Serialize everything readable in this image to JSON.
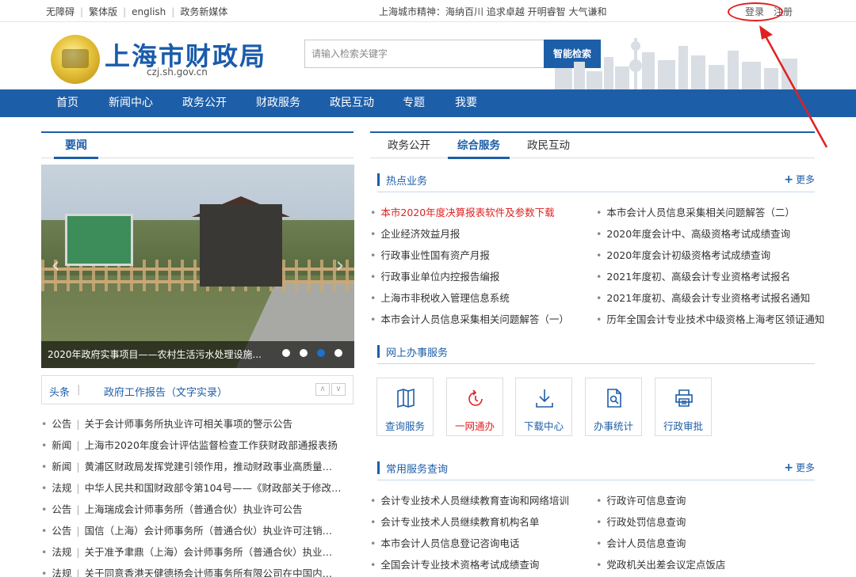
{
  "topbar": {
    "links": [
      "无障碍",
      "繁体版",
      "english",
      "政务新媒体"
    ],
    "spirit": "上海城市精神：海纳百川 追求卓越 开明睿智 大气谦和",
    "login": "登录",
    "register": "注册"
  },
  "header": {
    "title": "上海市财政局",
    "domain": "czj.sh.gov.cn",
    "search_placeholder": "请输入检索关键字",
    "search_button": "智能检索"
  },
  "nav": [
    "首页",
    "新闻中心",
    "政务公开",
    "财政服务",
    "政民互动",
    "专题",
    "我要"
  ],
  "left": {
    "tab": "要闻",
    "slide_caption": "2020年政府实事项目——农村生活污水处理设施...",
    "subtabs": [
      "头条",
      "政府工作报告（文字实录）"
    ],
    "news": [
      {
        "cat": "公告",
        "text": "关于会计师事务所执业许可相关事项的警示公告"
      },
      {
        "cat": "新闻",
        "text": "上海市2020年度会计评估监督检查工作获财政部通报表扬"
      },
      {
        "cat": "新闻",
        "text": "黄浦区财政局发挥党建引领作用，推动财政事业高质量…"
      },
      {
        "cat": "法规",
        "text": "中华人民共和国财政部令第104号——《财政部关于修改…"
      },
      {
        "cat": "公告",
        "text": "上海瑞成会计师事务所（普通合伙）执业许可公告"
      },
      {
        "cat": "公告",
        "text": "国信（上海）会计师事务所（普通合伙）执业许可注销…"
      },
      {
        "cat": "法规",
        "text": "关于准予聿鼎（上海）会计师事务所（普通合伙）执业…"
      },
      {
        "cat": "法规",
        "text": "关于同意香港天健德扬会计师事务所有限公司在中国内…"
      }
    ]
  },
  "right": {
    "tabs": [
      "政务公开",
      "综合服务",
      "政民互动"
    ],
    "hot": {
      "title": "热点业务",
      "more": "更多",
      "col1": [
        {
          "text": "本市2020年度决算报表软件及参数下载",
          "highlight": true
        },
        {
          "text": "企业经济效益月报"
        },
        {
          "text": "行政事业性国有资产月报"
        },
        {
          "text": "行政事业单位内控报告编报"
        },
        {
          "text": "上海市非税收入管理信息系统"
        },
        {
          "text": "本市会计人员信息采集相关问题解答（一）"
        }
      ],
      "col2": [
        {
          "text": "本市会计人员信息采集相关问题解答（二）"
        },
        {
          "text": "2020年度会计中、高级资格考试成绩查询"
        },
        {
          "text": "2020年度会计初级资格考试成绩查询"
        },
        {
          "text": "2021年度初、高级会计专业资格考试报名"
        },
        {
          "text": "2021年度初、高级会计专业资格考试报名通知"
        },
        {
          "text": "历年全国会计专业技术中级资格上海考区领证通知"
        }
      ]
    },
    "online": {
      "title": "网上办事服务",
      "services": [
        {
          "label": "查询服务",
          "icon": "book-icon"
        },
        {
          "label": "一网通办",
          "icon": "refresh-icon"
        },
        {
          "label": "下载中心",
          "icon": "download-icon"
        },
        {
          "label": "办事统计",
          "icon": "document-search-icon"
        },
        {
          "label": "行政审批",
          "icon": "printer-icon"
        }
      ]
    },
    "common": {
      "title": "常用服务查询",
      "more": "更多",
      "col1": [
        "会计专业技术人员继续教育查询和网络培训",
        "会计专业技术人员继续教育机构名单",
        "本市会计人员信息登记咨询电话",
        "全国会计专业技术资格考试成绩查询"
      ],
      "col2": [
        "行政许可信息查询",
        "行政处罚信息查询",
        "会计人员信息查询",
        "党政机关出差会议定点饭店"
      ]
    }
  },
  "colors": {
    "brand": "#1d5ea8",
    "highlight": "#e02020",
    "annotation": "#e02020"
  }
}
